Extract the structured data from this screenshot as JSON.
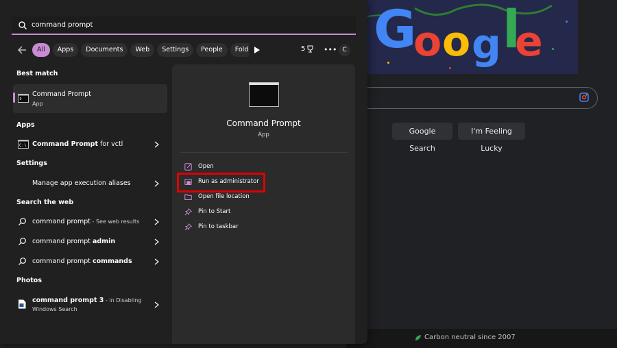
{
  "search": {
    "query": "command prompt"
  },
  "filters": {
    "chips": [
      "All",
      "Apps",
      "Documents",
      "Web",
      "Settings",
      "People",
      "Folde"
    ],
    "count": "5",
    "avatar_letter": "C"
  },
  "sections": {
    "best_match": "Best match",
    "apps": "Apps",
    "settings": "Settings",
    "search_web": "Search the web",
    "photos": "Photos"
  },
  "best_match": {
    "title": "Command Prompt",
    "subtitle": "App"
  },
  "apps_results": [
    {
      "title": "Command Prompt",
      "suffix": " for vctl"
    }
  ],
  "settings_results": [
    {
      "title": "Manage app execution aliases"
    }
  ],
  "web_results": [
    {
      "title": "command prompt",
      "suffix": " - See web results"
    },
    {
      "title": "command prompt admin",
      "suffix": ""
    },
    {
      "title": "command prompt commands",
      "suffix": ""
    }
  ],
  "photos_results": [
    {
      "title": "command prompt 3",
      "suffix": " - in Disabling",
      "line2": "Windows Search"
    }
  ],
  "preview": {
    "title": "Command Prompt",
    "type": "App",
    "actions": [
      {
        "label": "Open",
        "icon": "open-external-icon"
      },
      {
        "label": "Run as administrator",
        "icon": "shield-admin-icon"
      },
      {
        "label": "Open file location",
        "icon": "folder-icon"
      },
      {
        "label": "Pin to Start",
        "icon": "pin-icon"
      },
      {
        "label": "Pin to taskbar",
        "icon": "pin-icon"
      }
    ]
  },
  "google": {
    "logo_text": "Google",
    "search_button": "Google Search",
    "lucky_button": "I'm Feeling Lucky",
    "footer_text": "Carbon neutral since 2007"
  },
  "colors": {
    "accent": "#c98bd3",
    "highlight_box": "#e00000",
    "panel_bg": "#202020",
    "preview_bg": "#2b2b2b",
    "google_blue": "#4285f4",
    "google_red": "#ea4335",
    "google_yellow": "#fbbc05",
    "google_green": "#34a853"
  }
}
